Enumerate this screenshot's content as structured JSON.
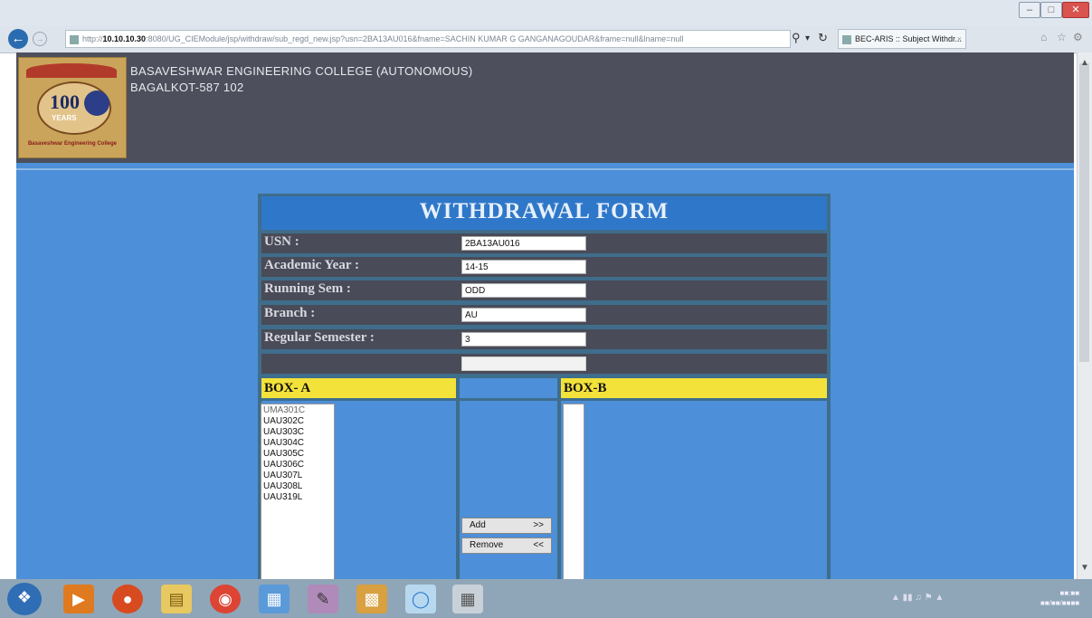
{
  "browser": {
    "url_prefix": "http://",
    "url_host": "10.10.10.30",
    "url_rest": ":8080/UG_CIEModule/jsp/withdraw/sub_regd_new.jsp?usn=2BA13AU016&fname=SACHIN KUMAR G GANGANAGOUDAR&frame=null&lname=null",
    "tab_title": "BEC-ARIS :: Subject Withdr...",
    "window_buttons": [
      "–",
      "□",
      "✕"
    ]
  },
  "header": {
    "college_name": "BASAVESHWAR ENGINEERING COLLEGE (AUTONOMOUS)",
    "college_city": "BAGALKOT-587 102",
    "logo": {
      "number": "100",
      "label": "YEARS",
      "caption": "Basaveshwar Engineering College"
    }
  },
  "form": {
    "title": "WITHDRAWAL FORM",
    "fields": [
      {
        "label": "USN :",
        "value": "2BA13AU016"
      },
      {
        "label": "Academic Year :",
        "value": "14-15"
      },
      {
        "label": "Running Sem :",
        "value": "ODD"
      },
      {
        "label": "Branch :",
        "value": "AU"
      },
      {
        "label": "Regular Semester :",
        "value": "3"
      }
    ],
    "box_a_label": "BOX- A",
    "box_b_label": "BOX-B",
    "box_a_items": [
      "UMA301C",
      "UAU302C",
      "UAU303C",
      "UAU304C",
      "UAU305C",
      "UAU306C",
      "UAU307L",
      "UAU308L",
      "UAU319L"
    ],
    "add_button": "Add",
    "add_arrow": ">>",
    "remove_button": "Remove",
    "remove_arrow": "<<"
  },
  "colors": {
    "page_bg": "#4d8fd8",
    "header_bg": "#4d4f5c",
    "form_title_bg": "#2f78c9",
    "box_header_bg": "#f3e23a"
  }
}
